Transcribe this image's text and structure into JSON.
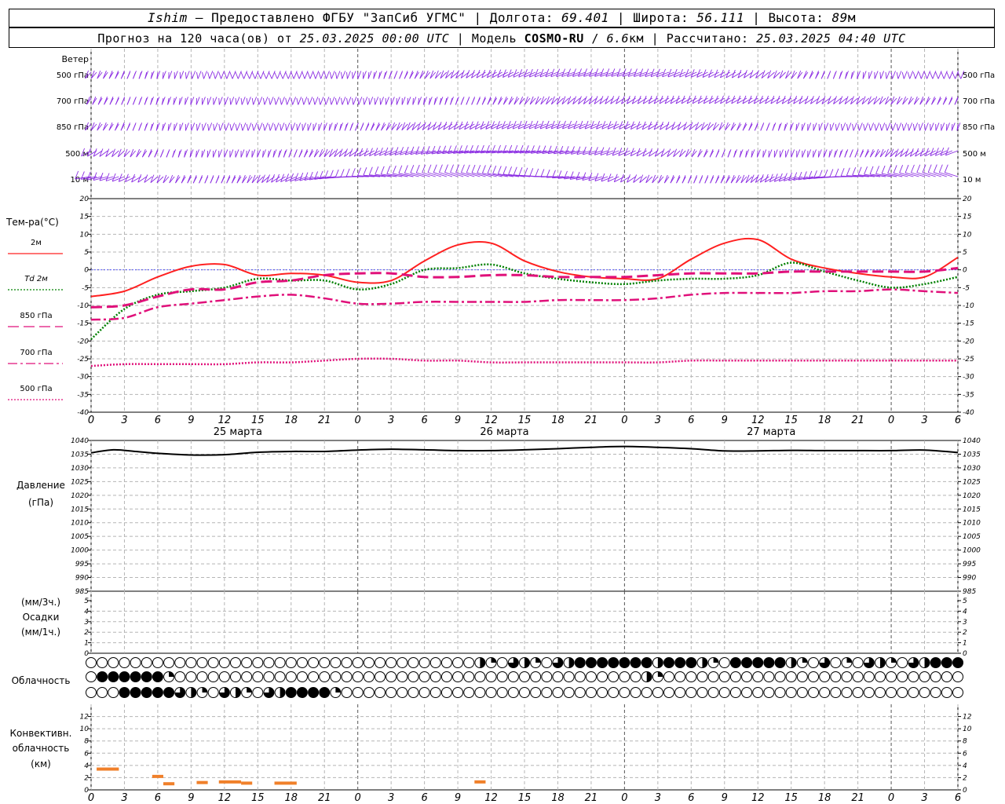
{
  "header": {
    "station": "Ishim",
    "dash": "–",
    "provider": "Предоставлено ФГБУ \"ЗапСиб УГМС\"",
    "lon_label": "Долгота:",
    "lon": "69.401",
    "lat_label": "Широта:",
    "lat": "56.111",
    "alt_label": "Высота:",
    "alt": "89",
    "alt_unit": "м",
    "forecast_prefix": "Прогноз на 120 часа(ов) от",
    "forecast_start": "25.03.2025 00:00 UTC",
    "model_label": "Модель",
    "model": "COSMO-RU",
    "model_res": "6.6",
    "model_res_unit": "км",
    "computed_label": "Рассчитано:",
    "computed": "25.03.2025 04:40 UTC"
  },
  "wind_panel": {
    "title": "Ветер",
    "levels": [
      "500 гПа",
      "700 гПа",
      "850 гПа",
      "500 м",
      "10 м"
    ],
    "right_levels": [
      "500 гПа",
      "700 гПа",
      "850 гПа",
      "500 м",
      "10 м"
    ],
    "color": "#8a2be2"
  },
  "temp_panel": {
    "title": "Тем-ра(°C)",
    "legend": [
      {
        "label": "2м",
        "color": "#ff2020",
        "style": "solid"
      },
      {
        "label": "Td  2м",
        "color": "#008000",
        "style": "dotted"
      },
      {
        "label": "850 гПа",
        "color": "#e0107a",
        "style": "dashed"
      },
      {
        "label": "700 гПа",
        "color": "#e0107a",
        "style": "dashdot"
      },
      {
        "label": "500 гПа",
        "color": "#e0107a",
        "style": "dotted"
      }
    ]
  },
  "pressure_panel": {
    "title1": "Давление",
    "title2": "(гПа)"
  },
  "precip_panel": {
    "title1": "(мм/3ч.)",
    "title2": "Осадки",
    "title3": "(мм/1ч.)"
  },
  "cloud_panel": {
    "title": "Облачность"
  },
  "conv_panel": {
    "title1": "Конвективн.",
    "title2": "облачность",
    "title3": "(км)"
  },
  "time_axis": {
    "hour_labels": [
      "0",
      "3",
      "6",
      "9",
      "12",
      "15",
      "18",
      "21",
      "0",
      "3",
      "6",
      "9",
      "12",
      "15",
      "18",
      "21",
      "0",
      "3",
      "6",
      "9",
      "12",
      "15",
      "18",
      "21",
      "0",
      "3",
      "6"
    ],
    "day_labels": [
      "25 марта",
      "26 марта",
      "27 марта"
    ]
  },
  "chart_data": [
    {
      "type": "line",
      "title": "Тем-ра(°C)",
      "x_unit": "hours from 25.03.2025 00:00 UTC",
      "ylim": [
        -40,
        20
      ],
      "yticks": [
        20,
        15,
        10,
        5,
        0,
        -5,
        -10,
        -15,
        -20,
        -25,
        -30,
        -35,
        -40
      ],
      "series": [
        {
          "name": "2м",
          "x": [
            0,
            3,
            6,
            9,
            12,
            15,
            18,
            21,
            24,
            27,
            30,
            33,
            36,
            39,
            42,
            45,
            48,
            51,
            54,
            57,
            60,
            63,
            66,
            69,
            72,
            75,
            78
          ],
          "values": [
            -7.5,
            -6,
            -2,
            1,
            1.5,
            -1.5,
            -1,
            -1.5,
            -3.5,
            -3,
            2.5,
            7,
            7.5,
            2.5,
            -0.5,
            -2,
            -2.5,
            -2.5,
            3,
            7.5,
            8.5,
            3,
            0.5,
            -1,
            -2,
            -2,
            3.5
          ]
        },
        {
          "name": "Td  2м",
          "x": [
            0,
            3,
            6,
            9,
            12,
            15,
            18,
            21,
            24,
            27,
            30,
            33,
            36,
            39,
            42,
            45,
            48,
            51,
            54,
            57,
            60,
            63,
            66,
            69,
            72,
            75,
            78
          ],
          "values": [
            -19.5,
            -11,
            -7,
            -6,
            -5,
            -2.5,
            -3,
            -3,
            -5.5,
            -4,
            0,
            0.5,
            1.5,
            -1,
            -2.5,
            -3.5,
            -4,
            -3,
            -2.5,
            -2.5,
            -1.5,
            2,
            -0.5,
            -3,
            -5,
            -4,
            -2
          ]
        },
        {
          "name": "850 гПа",
          "x": [
            0,
            3,
            6,
            9,
            12,
            15,
            18,
            21,
            24,
            27,
            30,
            33,
            36,
            39,
            42,
            45,
            48,
            51,
            54,
            57,
            60,
            63,
            66,
            69,
            72,
            75,
            78
          ],
          "values": [
            -10.5,
            -10,
            -7.5,
            -5.5,
            -5.5,
            -3.5,
            -3,
            -1.5,
            -1,
            -1,
            -2,
            -2,
            -1.5,
            -1.5,
            -2,
            -2,
            -2,
            -1.5,
            -1,
            -1,
            -1,
            -0.5,
            -0.5,
            -0.5,
            -0.5,
            -0.5,
            0.5
          ]
        },
        {
          "name": "700 гПа",
          "x": [
            0,
            3,
            6,
            9,
            12,
            15,
            18,
            21,
            24,
            27,
            30,
            33,
            36,
            39,
            42,
            45,
            48,
            51,
            54,
            57,
            60,
            63,
            66,
            69,
            72,
            75,
            78
          ],
          "values": [
            -14,
            -13.5,
            -10.5,
            -9.5,
            -8.5,
            -7.5,
            -7,
            -8,
            -9.5,
            -9.5,
            -9,
            -9,
            -9,
            -9,
            -8.5,
            -8.5,
            -8.5,
            -8,
            -7,
            -6.5,
            -6.5,
            -6.5,
            -6,
            -6,
            -5.5,
            -6,
            -6.5
          ]
        },
        {
          "name": "500 гПа",
          "x": [
            0,
            3,
            6,
            9,
            12,
            15,
            18,
            21,
            24,
            27,
            30,
            33,
            36,
            39,
            42,
            45,
            48,
            51,
            54,
            57,
            60,
            63,
            66,
            69,
            72,
            75,
            78
          ],
          "values": [
            -27,
            -26.5,
            -26.5,
            -26.5,
            -26.5,
            -26,
            -26,
            -25.5,
            -25,
            -25,
            -25.5,
            -25.5,
            -26,
            -26,
            -26,
            -26,
            -26,
            -26,
            -25.5,
            -25.5,
            -25.5,
            -25.5,
            -25.5,
            -25.5,
            -25.5,
            -25.5,
            -25.5
          ]
        }
      ]
    },
    {
      "type": "line",
      "title": "Давление",
      "ylabel": "(гПа)",
      "ylim": [
        985,
        1040
      ],
      "yticks": [
        1040,
        1035,
        1030,
        1025,
        1020,
        1015,
        1010,
        1005,
        1000,
        995,
        990,
        985
      ],
      "series": [
        {
          "x": [
            0,
            2,
            4,
            6,
            9,
            12,
            15,
            18,
            21,
            24,
            27,
            30,
            33,
            36,
            39,
            42,
            45,
            48,
            51,
            54,
            57,
            60,
            63,
            66,
            69,
            72,
            75,
            78
          ],
          "values": [
            1035.5,
            1036.6,
            1036,
            1035.3,
            1034.7,
            1034.8,
            1035.7,
            1036,
            1036,
            1036.5,
            1036.8,
            1036.6,
            1036.3,
            1036.3,
            1036.6,
            1037,
            1037.5,
            1037.8,
            1037.5,
            1037,
            1036.2,
            1036.2,
            1036.4,
            1036.3,
            1036.3,
            1036.3,
            1036.5,
            1035.6
          ]
        }
      ]
    },
    {
      "type": "bar",
      "title": "Осадки",
      "ylabel": "(мм/3ч.) / (мм/1ч.)",
      "ylim": [
        0,
        5
      ],
      "yticks": [
        5,
        4,
        3,
        2,
        1,
        0
      ],
      "values": []
    },
    {
      "type": "bar",
      "title": "Конвективн. облачность (км)",
      "ylim": [
        0,
        14
      ],
      "yticks": [
        12,
        10,
        8,
        6,
        4,
        2,
        0
      ],
      "segments": [
        {
          "x_start": 0.5,
          "x_end": 2.5,
          "value": 3.4
        },
        {
          "x_start": 5.5,
          "x_end": 6.5,
          "value": 2.2
        },
        {
          "x_start": 6.5,
          "x_end": 7.5,
          "value": 1.0
        },
        {
          "x_start": 9.5,
          "x_end": 10.5,
          "value": 1.2
        },
        {
          "x_start": 11.5,
          "x_end": 13.5,
          "value": 1.3
        },
        {
          "x_start": 13.5,
          "x_end": 14.5,
          "value": 1.1
        },
        {
          "x_start": 16.5,
          "x_end": 18.5,
          "value": 1.1
        },
        {
          "x_start": 34.5,
          "x_end": 35.5,
          "value": 1.3
        }
      ]
    }
  ]
}
